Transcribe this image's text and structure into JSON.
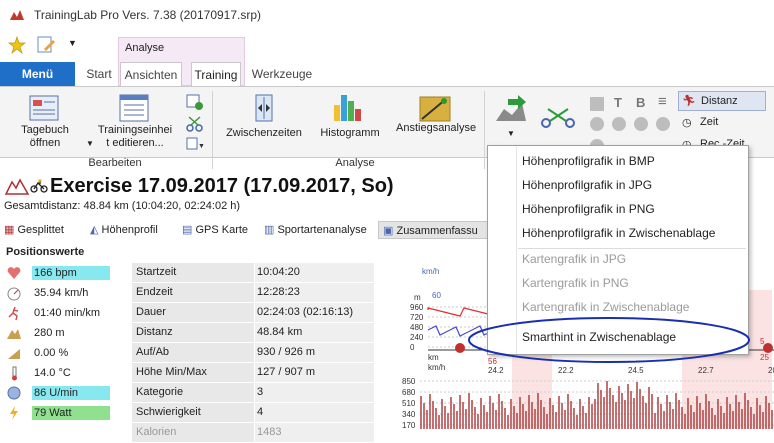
{
  "window": {
    "title": "TrainingLab Pro Vers. 7.38 (20170917.srp)"
  },
  "ribbon": {
    "context_tab": "Analyse",
    "menu_button": "Menü",
    "tabs": [
      "Start",
      "Ansichten",
      "Training",
      "Werkzeuge"
    ],
    "active_tab": "Training",
    "groups": {
      "bearbeiten": {
        "label": "Bearbeiten",
        "tagebuch_line1": "Tagebuch",
        "tagebuch_line2": "öffnen",
        "einheit_line1": "Trainingseinhei",
        "einheit_line2": "t editieren..."
      },
      "analyse": {
        "label": "Analyse",
        "zwischenzeiten": "Zwischenzeiten",
        "histogramm": "Histogramm",
        "anstieg": "Anstiegsanalyse"
      }
    },
    "right_options": [
      "Distanz",
      "Zeit",
      "Rec.-Zeit"
    ],
    "text_glyphs": [
      "T",
      "B",
      "≡"
    ]
  },
  "exercise": {
    "title": "Exercise 17.09.2017 (17.09.2017, So)",
    "subtitle": "Gesamtdistanz: 48.84 km (10:04:20, 02:24:02 h)"
  },
  "subtabs": [
    "Gesplittet",
    "Höhenprofil",
    "GPS Karte",
    "Sportartenanalyse",
    "Zusammenfassu"
  ],
  "positionswerte": {
    "heading": "Positionswerte",
    "items": [
      {
        "icon": "heart-icon",
        "value": "166 bpm",
        "highlight": "#87e8f0"
      },
      {
        "icon": "speedometer-icon",
        "value": "35.94 km/h",
        "highlight": ""
      },
      {
        "icon": "runner-icon",
        "value": "01:40 min/km",
        "highlight": ""
      },
      {
        "icon": "altitude-icon",
        "value": "280 m",
        "highlight": ""
      },
      {
        "icon": "slope-icon",
        "value": "0.00 %",
        "highlight": ""
      },
      {
        "icon": "thermometer-icon",
        "value": "14.0 °C",
        "highlight": ""
      },
      {
        "icon": "cadence-icon",
        "value": "86 U/min",
        "highlight": "#87e8f0"
      },
      {
        "icon": "power-icon",
        "value": "79 Watt",
        "highlight": "#8fe08f"
      }
    ]
  },
  "summary_table": [
    {
      "k": "Startzeit",
      "v": "10:04:20"
    },
    {
      "k": "Endzeit",
      "v": "12:28:23"
    },
    {
      "k": "Dauer",
      "v": "02:24:03 (02:16:13)"
    },
    {
      "k": "Distanz",
      "v": "48.84 km"
    },
    {
      "k": "Auf/Ab",
      "v": "930 / 926 m"
    },
    {
      "k": "Höhe Min/Max",
      "v": "127 / 907 m"
    },
    {
      "k": "Kategorie",
      "v": "3"
    },
    {
      "k": "Schwierigkeit",
      "v": "4"
    },
    {
      "k": "Kalorien",
      "v": "1483"
    }
  ],
  "chart": {
    "y_ticks_top": [
      "960",
      "720",
      "480",
      "240",
      "0"
    ],
    "unit_top": "km/h",
    "unit_m": "m",
    "km_label": "km",
    "kmh_label": "km/h",
    "markers_top": [
      "60",
      "5"
    ],
    "km_values": [
      "56",
      "25"
    ],
    "kmh_values": [
      "24.2",
      "22.2",
      "24.5",
      "22.7",
      "20.3"
    ],
    "y_ticks_bottom": [
      "850",
      "680",
      "510",
      "340",
      "170"
    ],
    "colors": {
      "heartrate": "#e03030",
      "speed": "#4a4ad0",
      "altitude": "#b04040",
      "zone": "#f8d0d0"
    }
  },
  "context_menu": {
    "items": [
      {
        "label": "Höhenprofilgrafik in BMP",
        "enabled": true
      },
      {
        "label": "Höhenprofilgrafik in JPG",
        "enabled": true
      },
      {
        "label": "Höhenprofilgrafik in PNG",
        "enabled": true
      },
      {
        "label": "Höhenprofilgrafik in Zwischenablage",
        "enabled": true
      },
      {
        "label": "Kartengrafik in JPG",
        "enabled": false
      },
      {
        "label": "Kartengrafik in PNG",
        "enabled": false
      },
      {
        "label": "Kartengrafik in Zwischenablage",
        "enabled": false
      },
      {
        "label": "Smarthint in Zwischenablage",
        "enabled": true
      }
    ],
    "highlight_color": "#1a2fb0"
  }
}
